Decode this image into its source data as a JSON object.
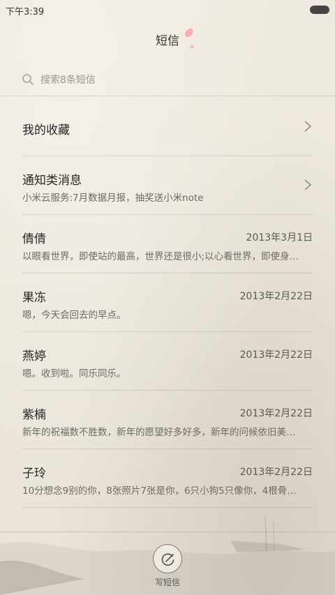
{
  "status": {
    "time": "下午3:39"
  },
  "header": {
    "title": "短信"
  },
  "search": {
    "placeholder": "搜索8条短信"
  },
  "list": {
    "favorites": {
      "name": "我的收藏"
    },
    "notice": {
      "name": "通知类消息",
      "preview": "小米云服务:7月数据月报，抽奖送小米note",
      "unread": true
    },
    "threads": [
      {
        "name": "倩倩",
        "date": "2013年3月1日",
        "preview": "以眼看世界，即使站的最高，世界还是很小;以心看世界，即使身…",
        "unread": false
      },
      {
        "name": "果冻",
        "date": "2013年2月22日",
        "preview": "嗯，今天会回去的早点。",
        "unread": false
      },
      {
        "name": "燕婷",
        "date": "2013年2月22日",
        "preview": "嗯。收到啦。同乐同乐。",
        "unread": true
      },
      {
        "name": "紫楠",
        "date": "2013年2月22日",
        "preview": "新年的祝福数不胜数，新年的愿望好多好多，新年的问候依旧美…",
        "unread": false
      },
      {
        "name": "子玲",
        "date": "2013年2月22日",
        "preview": "10分想念9别的你，8张照片7张是你，6只小狗5只像你，4根骨…",
        "unread": false
      }
    ]
  },
  "compose": {
    "label": "写短信"
  },
  "colors": {
    "unread_dot": "#ef6a2a",
    "background": "#ece7db"
  }
}
